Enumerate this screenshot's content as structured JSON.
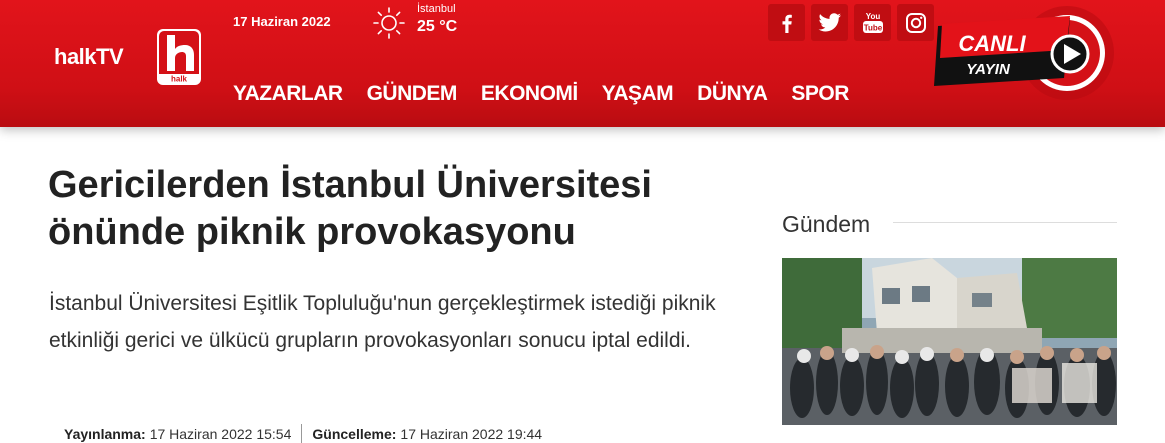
{
  "header": {
    "logo_text": "halkTV",
    "logo_small": "halk",
    "date": "17 Haziran 2022",
    "weather": {
      "city": "İstanbul",
      "temp": "25 °C",
      "icon": "sun-icon"
    },
    "nav": [
      "YAZARLAR",
      "GÜNDEM",
      "EKONOMİ",
      "YAŞAM",
      "DÜNYA",
      "SPOR"
    ],
    "social": [
      "facebook-icon",
      "twitter-icon",
      "youtube-icon",
      "instagram-icon"
    ],
    "youtube_label": "You Tube",
    "live": {
      "line1": "CANLI",
      "line2": "YAYIN"
    },
    "colors": {
      "brand_red": "#d41117",
      "dark_red": "#a80a0f"
    }
  },
  "article": {
    "headline": "Gericilerden İstanbul Üniversitesi önünde piknik provokasyonu",
    "lede": "İstanbul Üniversitesi Eşitlik Topluluğu'nun gerçekleştirmek istediği piknik etkinliği gerici ve ülkücü grupların provokasyonları sonucu iptal edildi.",
    "published_label": "Yayınlanma:",
    "published": "17 Haziran 2022 15:54",
    "updated_label": "Güncelleme:",
    "updated": "17 Haziran 2022 19:44"
  },
  "sidebar": {
    "title": "Gündem"
  }
}
